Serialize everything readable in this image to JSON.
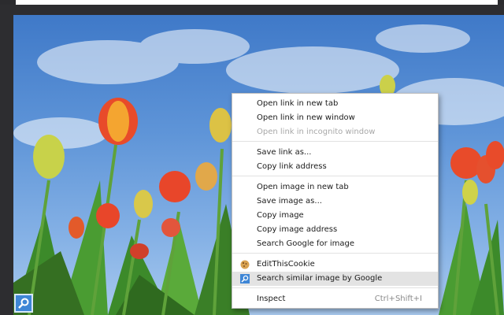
{
  "context_menu": {
    "items": [
      {
        "label": "Open link in new tab"
      },
      {
        "label": "Open link in new window"
      },
      {
        "label": "Open link in incognito window"
      },
      {
        "label": "Save link as..."
      },
      {
        "label": "Copy link address"
      },
      {
        "label": "Open image in new tab"
      },
      {
        "label": "Save image as..."
      },
      {
        "label": "Copy image"
      },
      {
        "label": "Copy image address"
      },
      {
        "label": "Search Google for image"
      },
      {
        "label": "EditThisCookie",
        "icon": "cookie-icon"
      },
      {
        "label": "Search similar image by Google",
        "icon": "image-search-icon"
      },
      {
        "label": "Inspect",
        "shortcut": "Ctrl+Shift+I"
      }
    ]
  },
  "image": {
    "subject": "tulip field under blue sky",
    "overlay_button_icon": "image-search-icon"
  },
  "colors": {
    "menu_highlight": "#e3e3e3",
    "disabled_text": "#a8a8a8",
    "accent_blue": "#3e86d6"
  }
}
